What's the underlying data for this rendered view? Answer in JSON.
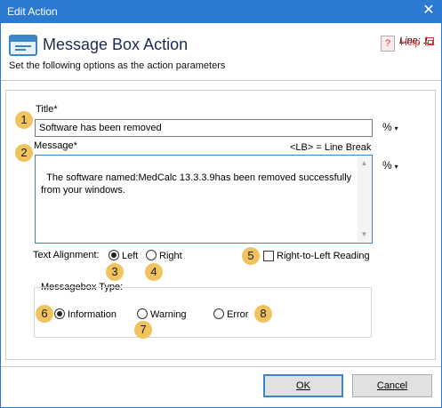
{
  "window": {
    "title": "Edit Action",
    "close_glyph": "✕"
  },
  "header": {
    "title": "Message Box Action",
    "line": "Line: 1",
    "subtitle": "Set the following options as the action parameters",
    "help_label": "Help",
    "help_glyph": "?"
  },
  "fields": {
    "title_label": "Title*",
    "title_value": "Software has been removed",
    "message_label": "Message*",
    "line_break_hint": "<LB> = Line Break",
    "message_value": "The software named:MedCalc 13.3.3.9has been removed successfully\nfrom your windows.",
    "percent_label": "%",
    "caret_glyph": "▾"
  },
  "alignment": {
    "label": "Text Alignment:",
    "left": "Left",
    "right": "Right",
    "selected": "Left",
    "rtl_label": "Right-to-Left Reading",
    "rtl_checked": false
  },
  "messagebox_type": {
    "label": "Messagebox Type:",
    "options": [
      "Information",
      "Warning",
      "Error"
    ],
    "selected": "Information"
  },
  "badges": [
    "1",
    "2",
    "3",
    "4",
    "5",
    "6",
    "7",
    "8"
  ],
  "buttons": {
    "ok": "OK",
    "cancel": "Cancel"
  },
  "colors": {
    "titlebar": "#2b79d0",
    "badge": "#f1c35f",
    "help": "#d33333"
  }
}
